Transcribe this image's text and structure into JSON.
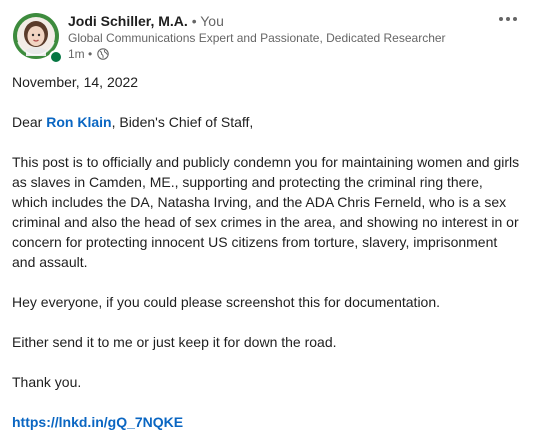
{
  "post": {
    "author": {
      "name": "Jodi Schiller, M.A.",
      "separator": " • ",
      "relation": "You",
      "headline": "Global Communications Expert and Passionate, Dedicated Researcher",
      "time": "1m • ",
      "visibility_icon": "globe-icon",
      "status_color": "#057642"
    },
    "more_icon": "ellipsis-icon",
    "body": {
      "date": "November, 14, 2022",
      "salutation_prefix": "Dear ",
      "mention": "Ron Klain",
      "salutation_suffix": ", Biden's Chief of Staff,",
      "paragraph1": "This post is to officially and publicly condemn you for maintaining women and girls as slaves in Camden, ME., supporting and protecting the criminal ring there, which includes the DA, Natasha Irving, and the ADA Chris Ferneld, who is a sex criminal and also the head of sex crimes in the area, and showing no interest in or concern for protecting innocent US citizens from torture, slavery, imprisonment and assault.",
      "paragraph2": "Hey everyone, if you could please screenshot this for documentation.",
      "paragraph3": "Either send it to me or just keep it for down the road.",
      "closing": "Thank you.",
      "link": "https://lnkd.in/gQ_7NQKE"
    },
    "colors": {
      "link": "#0a66c2",
      "text": "#1f1f1f",
      "muted": "#666666"
    }
  }
}
